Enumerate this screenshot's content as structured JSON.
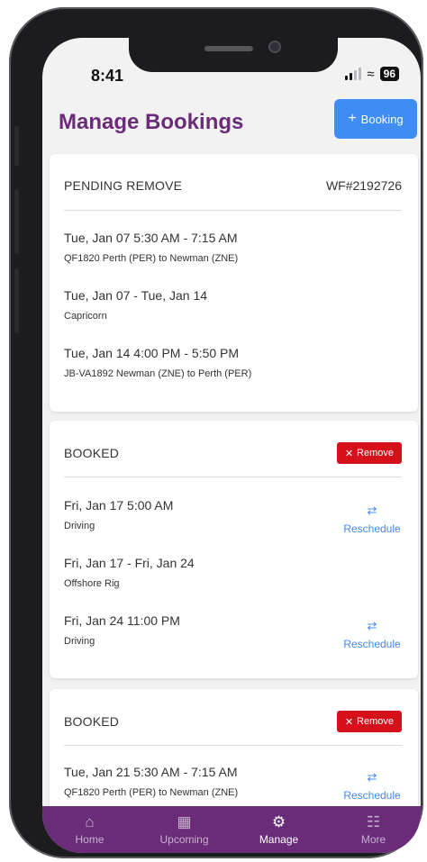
{
  "status_bar": {
    "time": "8:41",
    "battery": "96"
  },
  "header": {
    "title": "Manage Bookings",
    "add_booking_label": "Booking",
    "add_icon": "plus-icon"
  },
  "bookings": [
    {
      "status": "PENDING REMOVE",
      "reference": "WF#2192726",
      "legs": [
        {
          "title": "Tue, Jan 07 5:30 AM - 7:15 AM",
          "subtitle": "QF1820 Perth (PER) to Newman (ZNE)"
        },
        {
          "title": "Tue, Jan 07 - Tue, Jan 14",
          "subtitle": "Capricorn"
        },
        {
          "title": "Tue, Jan 14 4:00 PM - 5:50 PM",
          "subtitle": "JB-VA1892 Newman (ZNE) to Perth (PER)"
        }
      ]
    },
    {
      "status": "BOOKED",
      "remove_label": "Remove",
      "legs": [
        {
          "title": "Fri, Jan 17 5:00 AM",
          "subtitle": "Driving",
          "action": "Reschedule"
        },
        {
          "title": "Fri, Jan 17 - Fri, Jan 24",
          "subtitle": "Offshore Rig"
        },
        {
          "title": "Fri, Jan 24 11:00 PM",
          "subtitle": "Driving",
          "action": "Reschedule"
        }
      ]
    },
    {
      "status": "BOOKED",
      "remove_label": "Remove",
      "legs": [
        {
          "title": "Tue, Jan 21 5:30 AM - 7:15 AM",
          "subtitle": "QF1820 Perth (PER) to Newman (ZNE)",
          "action": "Reschedule"
        }
      ]
    }
  ],
  "tabbar": {
    "items": [
      {
        "label": "Home",
        "icon": "home-icon"
      },
      {
        "label": "Upcoming",
        "icon": "calendar-icon"
      },
      {
        "label": "Manage",
        "icon": "gear-icon",
        "active": true
      },
      {
        "label": "More",
        "icon": "grid-icon"
      }
    ]
  },
  "colors": {
    "primary": "#6a2c79",
    "accent": "#3f8cf2",
    "danger": "#d6101a"
  }
}
